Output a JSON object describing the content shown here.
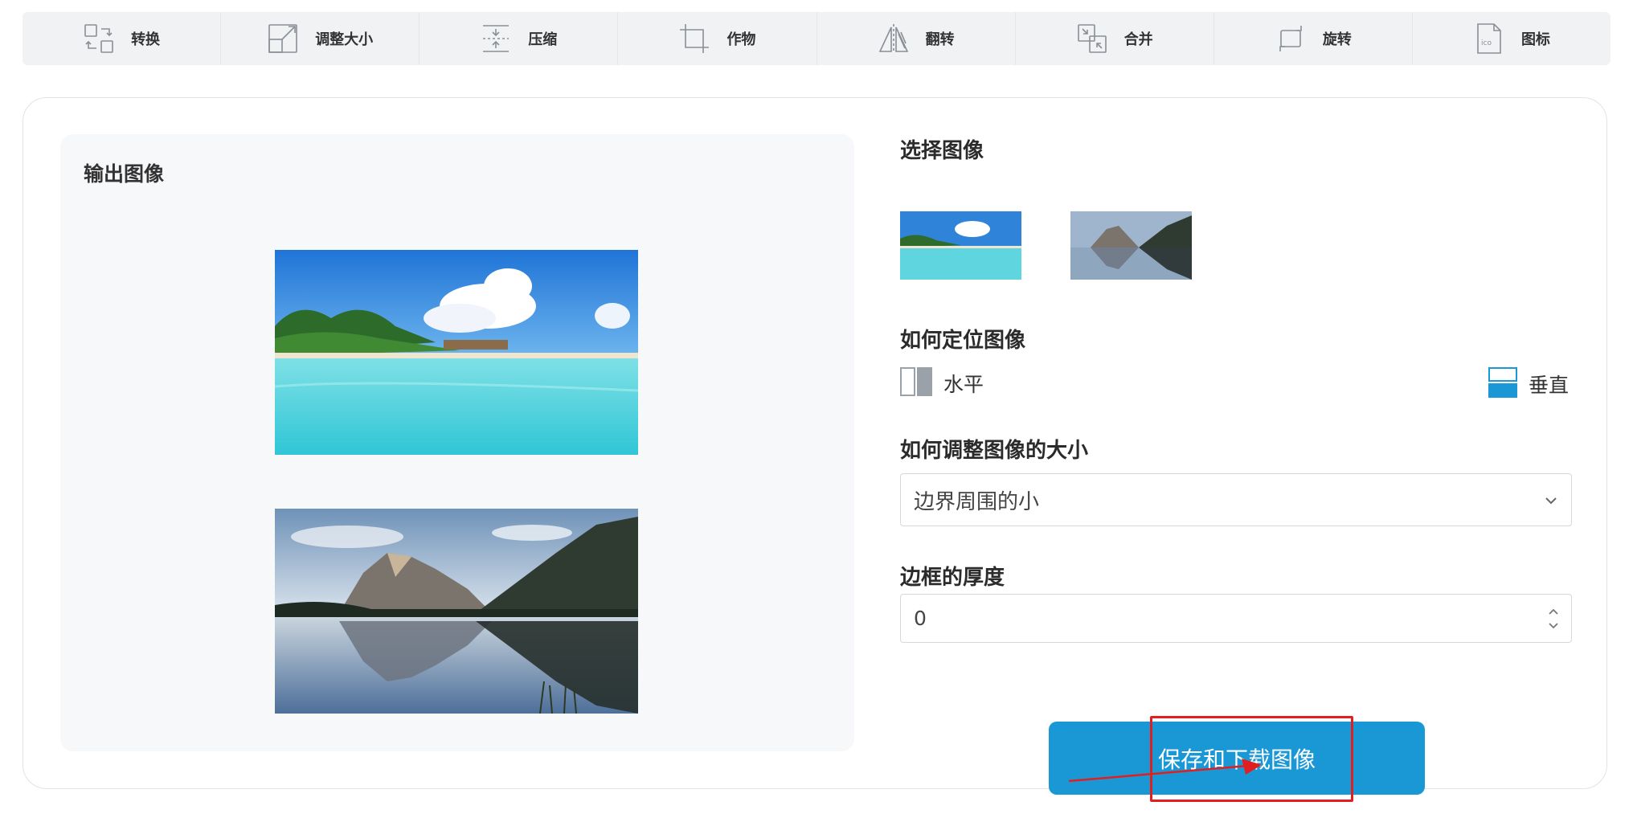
{
  "toolbar": {
    "items": [
      {
        "label": "转换",
        "icon": "convert-icon"
      },
      {
        "label": "调整大小",
        "icon": "resize-icon"
      },
      {
        "label": "压缩",
        "icon": "compress-icon"
      },
      {
        "label": "作物",
        "icon": "crop-icon"
      },
      {
        "label": "翻转",
        "icon": "flip-icon"
      },
      {
        "label": "合并",
        "icon": "merge-icon"
      },
      {
        "label": "旋转",
        "icon": "rotate-icon"
      },
      {
        "label": "图标",
        "icon": "ico-icon"
      }
    ]
  },
  "output": {
    "title": "输出图像",
    "images": [
      "tropical-beach-image",
      "mountain-lake-image"
    ]
  },
  "select_images": {
    "title": "选择图像",
    "thumbnails": [
      "tropical-beach-thumbnail",
      "mountain-lake-thumbnail"
    ]
  },
  "positioning": {
    "title": "如何定位图像",
    "horizontal_label": "水平",
    "vertical_label": "垂直",
    "selected": "vertical"
  },
  "resize": {
    "title": "如何调整图像的大小",
    "selected_value": "边界周围的小"
  },
  "border": {
    "title": "边框的厚度",
    "value": "0"
  },
  "actions": {
    "save_label": "保存和下载图像"
  },
  "colors": {
    "accent": "#1a98d5",
    "toolbar_bg": "#f1f2f4",
    "panel_bg": "#f7f8fa",
    "annotation_red": "#e02020"
  }
}
